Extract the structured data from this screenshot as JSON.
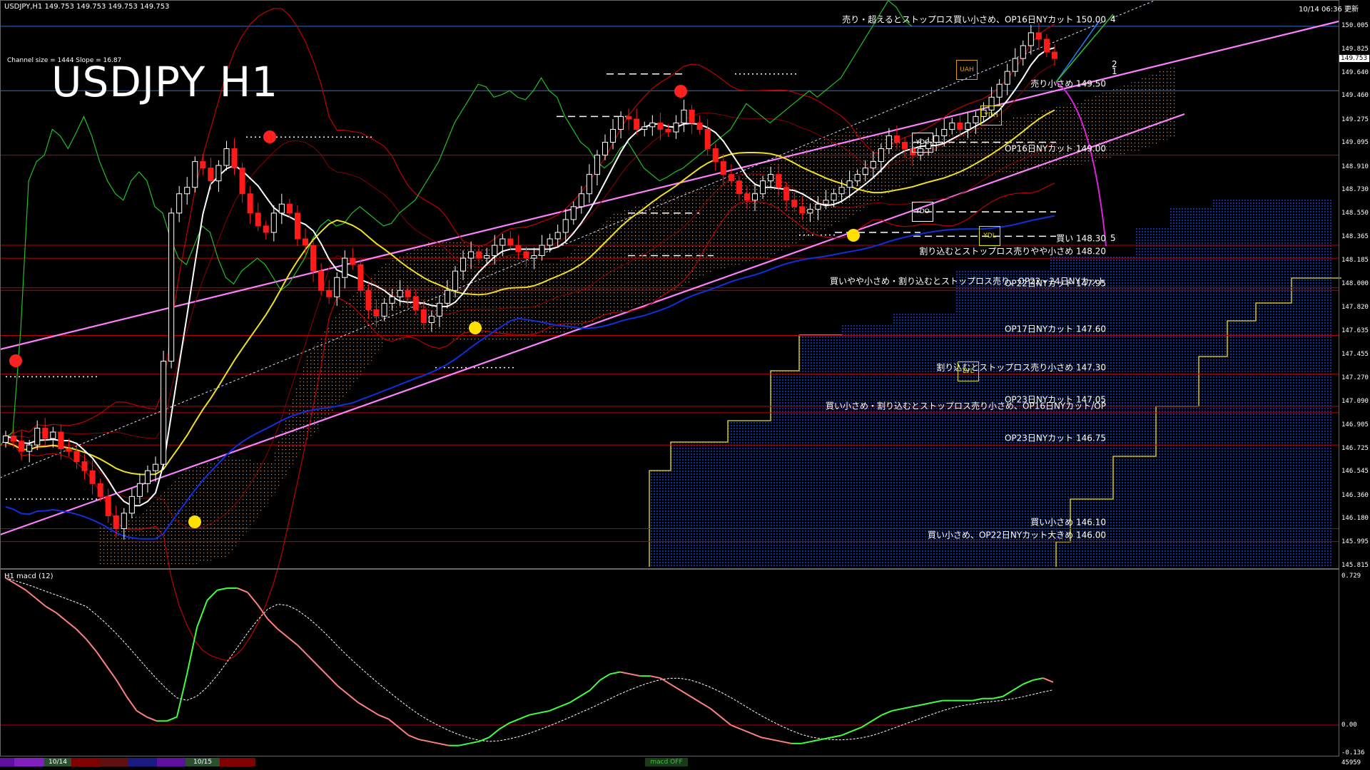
{
  "header": {
    "symbol_line": "USDJPY,H1  149.753 149.753 149.753 149.753",
    "datetime": "10/14 06:36 更新",
    "channel_info": "Channel size = 1444 Slope = 16.87",
    "title": "USDJPY H1",
    "macd_label": "H1  macd (12)"
  },
  "colors": {
    "background": "#000000",
    "bull_candle": "#ffffff",
    "bear_candle": "#ff1a1a",
    "ma_white": "#ffffff",
    "ma_yellow": "#f0e020",
    "ma_blue": "#1030e0",
    "channel": "#ff80ff",
    "bollinger": "#c00000",
    "lagging_span": "#20c020",
    "level_red": "#c00000",
    "level_blue": "#3070d0",
    "cloud_orange": "#d09060",
    "cloud_blue": "#1030a0",
    "macd_main": "#40ff40",
    "macd_main_down": "#ff8080",
    "macd_signal": "#ffffff"
  },
  "price_axis": {
    "min": 145.815,
    "max": 150.005,
    "labels": [
      "150.005",
      "149.825",
      "149.640",
      "149.460",
      "149.275",
      "149.095",
      "148.910",
      "148.730",
      "148.550",
      "148.365",
      "148.185",
      "148.000",
      "147.820",
      "147.635",
      "147.455",
      "147.270",
      "147.090",
      "146.905",
      "146.725",
      "146.545",
      "146.360",
      "146.180",
      "145.995",
      "145.815"
    ],
    "current": "149.753"
  },
  "macd_axis": {
    "min": -0.136,
    "max": 0.729,
    "labels": [
      "0.729",
      "0.00",
      "-0.136"
    ],
    "bottom_label": "45959"
  },
  "levels": [
    {
      "price": 150.0,
      "text": "売り・超えるとストップロス買い小さめ、OP16日NYカット 150.00",
      "tag": "4",
      "line": "blue"
    },
    {
      "price": 149.5,
      "text": "売り小さめ 149.50",
      "tag": "",
      "line": "blue"
    },
    {
      "price": 149.0,
      "text": "OP16日NYカット 149.00",
      "tag": "",
      "line": "red"
    },
    {
      "price": 148.3,
      "text": "買い 148.30",
      "tag": "5",
      "line": "red"
    },
    {
      "price": 148.2,
      "text": "割り込むとストップロス売りやや小さめ 148.20",
      "tag": "",
      "line": "red"
    },
    {
      "price": 147.97,
      "text": "買いやや小さめ・割り込むとストップロス売り、OP22・24日NYカット",
      "tag": "",
      "line": "red"
    },
    {
      "price": 147.95,
      "text": "OP22日NYカット 147.95",
      "tag": "",
      "line": "red"
    },
    {
      "price": 147.6,
      "text": "OP17日NYカット 147.60",
      "tag": "",
      "line": "red"
    },
    {
      "price": 147.3,
      "text": "割り込むとストップロス売り小さめ 147.30",
      "tag": "",
      "line": "red"
    },
    {
      "price": 147.05,
      "text": "OP23日NYカット 147.05",
      "tag": "",
      "line": "red"
    },
    {
      "price": 147.0,
      "text": "買い小さめ・割り込むとストップロス売り小さめ、OP16日NYカット/OP",
      "tag": "",
      "line": "red"
    },
    {
      "price": 146.75,
      "text": "OP23日NYカット 146.75",
      "tag": "",
      "line": "red"
    },
    {
      "price": 146.1,
      "text": "買い小さめ 146.10",
      "tag": "",
      "line": "red"
    },
    {
      "price": 146.0,
      "text": "買い小さめ、OP22日NYカット大きめ 146.00",
      "tag": "",
      "line": "red"
    }
  ],
  "markers": [
    {
      "label": "UAH",
      "price": 149.66,
      "color": "#e0a000"
    },
    {
      "label": "YDH",
      "price": 149.31,
      "color": "#e0e000"
    },
    {
      "label": "YDC",
      "price": 149.1,
      "color": "#ffffff"
    },
    {
      "label": "YDO",
      "price": 148.56,
      "color": "#ffffff"
    },
    {
      "label": "YDL",
      "price": 148.37,
      "color": "#e0e000"
    },
    {
      "label": "LVL",
      "price": 147.32,
      "color": "#e0e000"
    }
  ],
  "channel_tags": [
    "2",
    "1"
  ],
  "time_axis": {
    "labels": [
      "10/14",
      "10/15"
    ]
  },
  "macd_footer": "macd OFF",
  "chart_data": {
    "type": "candlestick",
    "title": "USDJPY H1",
    "indicators": [
      "SMA white",
      "SMA yellow",
      "SMA blue",
      "Bollinger bands",
      "Ichimoku cloud",
      "Chikou span",
      "Regression channel"
    ],
    "ohlc_close_approx": [
      146.82,
      146.78,
      146.7,
      146.75,
      146.88,
      146.8,
      146.85,
      146.72,
      146.7,
      146.62,
      146.55,
      146.45,
      146.35,
      146.2,
      146.1,
      146.22,
      146.35,
      146.45,
      146.55,
      146.6,
      147.4,
      148.55,
      148.7,
      148.75,
      148.95,
      148.9,
      148.8,
      148.92,
      149.05,
      148.9,
      148.7,
      148.55,
      148.45,
      148.4,
      148.55,
      148.62,
      148.55,
      148.35,
      148.3,
      148.1,
      147.95,
      147.9,
      148.05,
      148.2,
      148.15,
      147.95,
      147.8,
      147.75,
      147.85,
      147.9,
      147.95,
      147.9,
      147.8,
      147.7,
      147.75,
      147.85,
      147.95,
      148.1,
      148.2,
      148.25,
      148.2,
      148.22,
      148.3,
      148.35,
      148.3,
      148.25,
      148.2,
      148.22,
      148.3,
      148.35,
      148.4,
      148.5,
      148.6,
      148.7,
      148.85,
      149.0,
      149.1,
      149.2,
      149.3,
      149.28,
      149.2,
      149.22,
      149.25,
      149.2,
      149.18,
      149.25,
      149.35,
      149.25,
      149.2,
      149.05,
      148.95,
      148.85,
      148.8,
      148.7,
      148.65,
      148.7,
      148.8,
      148.85,
      148.75,
      148.65,
      148.6,
      148.55,
      148.58,
      148.62,
      148.65,
      148.7,
      148.75,
      148.8,
      148.85,
      148.9,
      148.95,
      149.05,
      149.15,
      149.1,
      149.05,
      149.0,
      149.05,
      149.1,
      149.15,
      149.2,
      149.25,
      149.2,
      149.25,
      149.3,
      149.35,
      149.45,
      149.55,
      149.65,
      149.75,
      149.85,
      149.95,
      149.9,
      149.8,
      149.75
    ],
    "macd": [
      0.72,
      0.69,
      0.66,
      0.62,
      0.58,
      0.55,
      0.51,
      0.47,
      0.42,
      0.36,
      0.29,
      0.22,
      0.14,
      0.07,
      0.04,
      0.02,
      0.02,
      0.04,
      0.25,
      0.48,
      0.61,
      0.66,
      0.67,
      0.67,
      0.65,
      0.59,
      0.52,
      0.47,
      0.43,
      0.39,
      0.34,
      0.29,
      0.24,
      0.19,
      0.15,
      0.11,
      0.08,
      0.05,
      0.03,
      -0.01,
      -0.05,
      -0.07,
      -0.08,
      -0.09,
      -0.1,
      -0.1,
      -0.09,
      -0.08,
      -0.06,
      -0.02,
      0.01,
      0.03,
      0.05,
      0.06,
      0.07,
      0.09,
      0.11,
      0.14,
      0.17,
      0.22,
      0.25,
      0.26,
      0.25,
      0.24,
      0.24,
      0.23,
      0.2,
      0.17,
      0.14,
      0.11,
      0.08,
      0.04,
      0.0,
      -0.02,
      -0.04,
      -0.06,
      -0.07,
      -0.08,
      -0.09,
      -0.09,
      -0.08,
      -0.07,
      -0.06,
      -0.05,
      -0.03,
      -0.01,
      0.02,
      0.05,
      0.07,
      0.08,
      0.09,
      0.1,
      0.11,
      0.12,
      0.12,
      0.12,
      0.12,
      0.13,
      0.13,
      0.14,
      0.17,
      0.2,
      0.22,
      0.23,
      0.21
    ],
    "ylim": [
      145.815,
      150.005
    ]
  }
}
